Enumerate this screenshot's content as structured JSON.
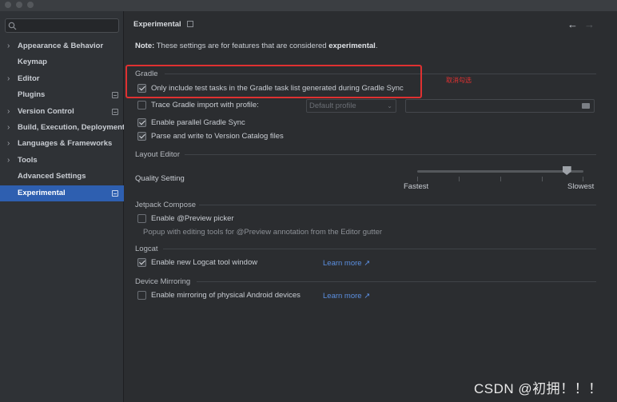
{
  "sidebar": {
    "search_placeholder": "Q",
    "items": [
      {
        "label": "Appearance & Behavior",
        "arrow": "›"
      },
      {
        "label": "Keymap"
      },
      {
        "label": "Editor",
        "arrow": "›"
      },
      {
        "label": "Plugins"
      },
      {
        "label": "Version Control",
        "arrow": "›"
      },
      {
        "label": "Build, Execution, Deployment",
        "arrow": "›"
      },
      {
        "label": "Languages & Frameworks",
        "arrow": "›"
      },
      {
        "label": "Tools",
        "arrow": "›"
      },
      {
        "label": "Advanced Settings"
      },
      {
        "label": "Experimental"
      }
    ]
  },
  "header": {
    "title": "Experimental",
    "back": "←",
    "forward": "→"
  },
  "note": {
    "prefix": "Note:",
    "text": " These settings are for features that are considered ",
    "bold": "experimental",
    "suffix": "."
  },
  "gradle": {
    "title": "Gradle",
    "opt_test_tasks": "Only include test tasks in the Gradle task list generated during Gradle Sync",
    "opt_trace": "Trace Gradle import with profile:",
    "profile_placeholder": "Default profile",
    "opt_parallel": "Enable parallel Gradle Sync",
    "opt_catalog": "Parse and write to Version Catalog files"
  },
  "layout_editor": {
    "title": "Layout Editor",
    "quality_label": "Quality Setting",
    "min_label": "Fastest",
    "max_label": "Slowest",
    "level": 0.9
  },
  "compose": {
    "title": "Jetpack Compose",
    "opt_picker": "Enable @Preview picker",
    "hint": "Popup with editing tools for @Preview annotation from the Editor gutter"
  },
  "logcat": {
    "title": "Logcat",
    "opt_new_window": "Enable new Logcat tool window",
    "learn_more": "Learn more ↗"
  },
  "mirroring": {
    "title": "Device Mirroring",
    "opt_mirroring": "Enable mirroring of physical Android devices",
    "learn_more": "Learn more ↗"
  },
  "annotation": {
    "text": "取消勾选",
    "color": "#e03131"
  },
  "watermark": "CSDN @初拥！！！",
  "colors": {
    "accent": "#2e5fb0",
    "link": "#5b8fe0",
    "background": "#2b2d30"
  }
}
